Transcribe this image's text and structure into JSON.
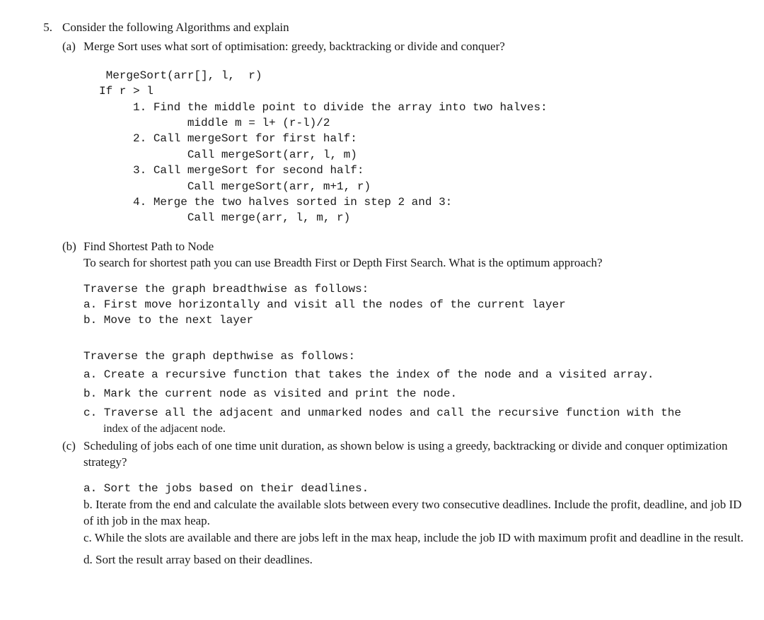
{
  "question_number": "5.",
  "intro": "Consider the following Algorithms and explain",
  "parts": {
    "a": {
      "label": "(a)",
      "prompt": "Merge Sort uses what sort of optimisation: greedy, backtracking or divide and conquer?",
      "code": " MergeSort(arr[], l,  r)\nIf r > l\n     1. Find the middle point to divide the array into two halves:\n             middle m = l+ (r-l)/2\n     2. Call mergeSort for first half:\n             Call mergeSort(arr, l, m)\n     3. Call mergeSort for second half:\n             Call mergeSort(arr, m+1, r)\n     4. Merge the two halves sorted in step 2 and 3:\n             Call merge(arr, l, m, r)"
    },
    "b": {
      "label": "(b)",
      "title": "Find Shortest Path to Node",
      "prompt": "To search for shortest path you can use Breadth First or Depth First Search. What is the optimum approach?",
      "bfs": "Traverse the graph breadthwise as follows:\na. First move horizontally and visit all the nodes of the current layer\nb. Move to the next layer",
      "dfs_line1": "Traverse the graph depthwise as follows:",
      "dfs_line2": "a. Create a recursive function that takes the index of the node and a visited array.",
      "dfs_line3": "b. Mark the current node as visited and print the node.",
      "dfs_line4_mono": "c. Traverse all the adjacent and unmarked nodes and call the recursive function with the",
      "dfs_line4_tail": "index of the adjacent node."
    },
    "c": {
      "label": "(c)",
      "prompt": "Scheduling of jobs each of one time unit duration, as shown below is using a greedy, backtracking or divide and conquer optimization strategy?",
      "step_a_mono": "a. Sort the jobs based on their deadlines.",
      "step_b": "b. Iterate from the end and calculate the available slots between every two consecutive deadlines. Include the profit, deadline, and job ID of ith job in the max heap.",
      "step_c": "c. While the slots are available and there are jobs left in the max heap, include the job ID with maximum profit and deadline in the result.",
      "step_d": "d. Sort the result array based on their deadlines."
    }
  }
}
